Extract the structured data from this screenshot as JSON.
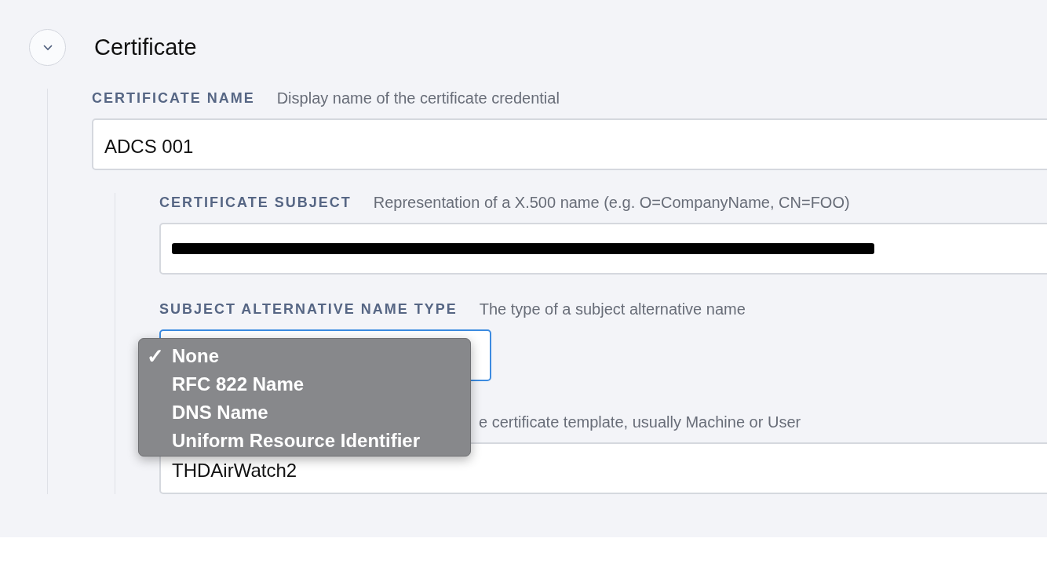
{
  "section": {
    "title": "Certificate",
    "expanded": true
  },
  "name_field": {
    "label": "CERTIFICATE NAME",
    "description": "Display name of the certificate credential",
    "value": "ADCS 001"
  },
  "subject_field": {
    "label": "CERTIFICATE SUBJECT",
    "description": "Representation of a X.500 name (e.g. O=CompanyName, CN=FOO)",
    "redacted": true
  },
  "san_field": {
    "label": "SUBJECT ALTERNATIVE NAME TYPE",
    "description": "The type of a subject alternative name",
    "focused": true
  },
  "san_menu": {
    "check_glyph": "✓",
    "options": [
      {
        "label": "None",
        "selected": true
      },
      {
        "label": "RFC 822 Name",
        "selected": false
      },
      {
        "label": "DNS Name",
        "selected": false
      },
      {
        "label": "Uniform Resource Identifier",
        "selected": false
      }
    ]
  },
  "template_field": {
    "description": "e certificate template, usually Machine or User",
    "value": "THDAirWatch2"
  }
}
